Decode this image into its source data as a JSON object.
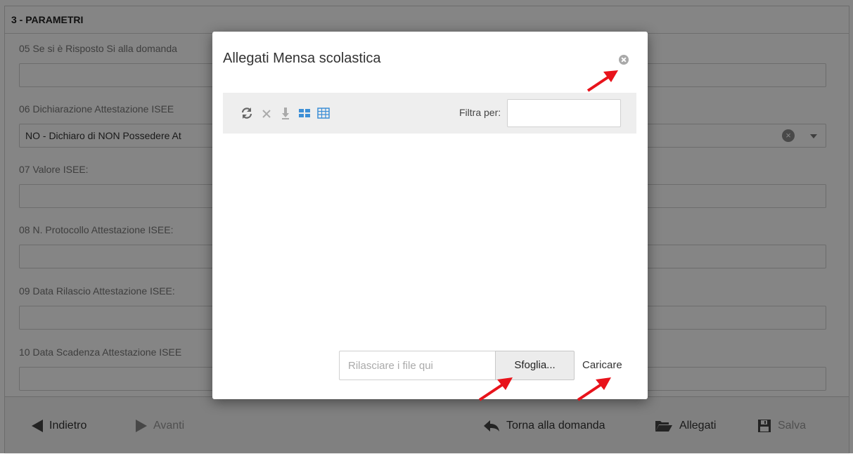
{
  "form": {
    "section_title": "3 - PARAMETRI",
    "fields": [
      {
        "label": "05 Se si è Risposto Si alla domanda",
        "value": ""
      },
      {
        "label": "06 Dichiarazione Attestazione ISEE",
        "value": "NO - Dichiaro di NON Possedere At"
      },
      {
        "label": "07 Valore ISEE:",
        "value": ""
      },
      {
        "label": "08 N. Protocollo Attestazione ISEE:",
        "value": ""
      },
      {
        "label": "09 Data Rilascio Attestazione ISEE:",
        "value": ""
      },
      {
        "label": "10 Data Scadenza Attestazione ISEE",
        "value": ""
      }
    ]
  },
  "footer": {
    "back_label": "Indietro",
    "next_label": "Avanti",
    "return_label": "Torna alla domanda",
    "attachments_label": "Allegati",
    "save_label": "Salva"
  },
  "modal": {
    "title": "Allegati Mensa scolastica",
    "toolbar_icons": [
      "refresh-icon",
      "delete-icon",
      "download-icon",
      "tile-view-icon",
      "grid-view-icon"
    ],
    "filter_label": "Filtra per:",
    "filter_value": "",
    "drop_placeholder": "Rilasciare i file qui",
    "browse_label": "Sfoglia...",
    "upload_label": "Caricare"
  },
  "colors": {
    "arrow": "#e8131b",
    "overlay": "rgba(0,0,0,0.48)",
    "toolbar_icon": "#7a7a7a",
    "toolbar_blue": "#3d8fd6"
  }
}
